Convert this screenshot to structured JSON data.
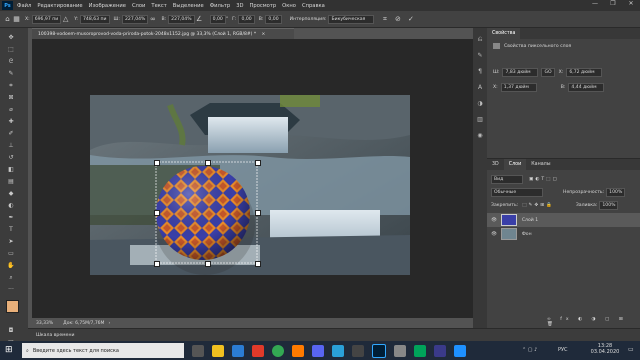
{
  "menubar": {
    "app_icon": "Ps",
    "items": [
      "Файл",
      "Редактирование",
      "Изображение",
      "Слои",
      "Текст",
      "Выделение",
      "Фильтр",
      "3D",
      "Просмотр",
      "Окно",
      "Справка"
    ],
    "window_controls": [
      "—",
      "❐",
      "✕"
    ]
  },
  "options": {
    "x_label": "X:",
    "x_value": "696,97 пи",
    "y_label": "Y:",
    "y_value": "748,63 пи",
    "w_label": "Ш:",
    "w_value": "227,04%",
    "h_label": "В:",
    "h_value": "227,04%",
    "angle_value": "0,00",
    "angle_unit": "°",
    "skew_h_label": "Г:",
    "skew_h_value": "0,00",
    "skew_v_label": "В:",
    "skew_v_value": "0,00",
    "interp_label": "Интерполяция:",
    "interp_value": "Бикубическая"
  },
  "document": {
    "tab_title": "100398-vodoem-musoroprovod-voda-priroda-potok-2048x1152.jpg @ 33,3% (Слой 1, RGB/8#) *",
    "close_icon": "×"
  },
  "status": {
    "zoom": "33,33%",
    "doc_info": "Док: 6,75M/7,76M",
    "arrow": "›"
  },
  "timeline": {
    "label": "Шкала времени"
  },
  "properties": {
    "tab": "Свойства",
    "subtitle": "Свойства пиксельного слоя",
    "w_label": "Ш:",
    "w_value": "7,83 дюйм",
    "h_label": "В:",
    "h_value": "4,44 дюйм",
    "x_label": "X:",
    "x_value": "6,72 дюйм",
    "x2_label": "X:",
    "x2_value": "1,37 дюйм",
    "link": "GO"
  },
  "layers": {
    "tabs": [
      "3D",
      "Слои",
      "Каналы"
    ],
    "active_tab": "Слои",
    "kind_label": "Вид",
    "blend_mode": "Обычные",
    "opacity_label": "Непрозрачность:",
    "opacity_value": "100%",
    "lock_label": "Закрепить:",
    "fill_label": "Заливка:",
    "fill_value": "100%",
    "items": [
      {
        "name": "Слой 1",
        "visible": true,
        "selected": true
      },
      {
        "name": "Фон",
        "visible": true,
        "selected": false
      }
    ]
  },
  "taskbar": {
    "search_placeholder": "Введите здесь текст для поиска",
    "language": "РУС",
    "time": "13:28",
    "date": "03.04.2020"
  },
  "colors": {
    "foreground": "#e9b07a",
    "background": "#ffffff",
    "accent": "#31a8ff"
  }
}
